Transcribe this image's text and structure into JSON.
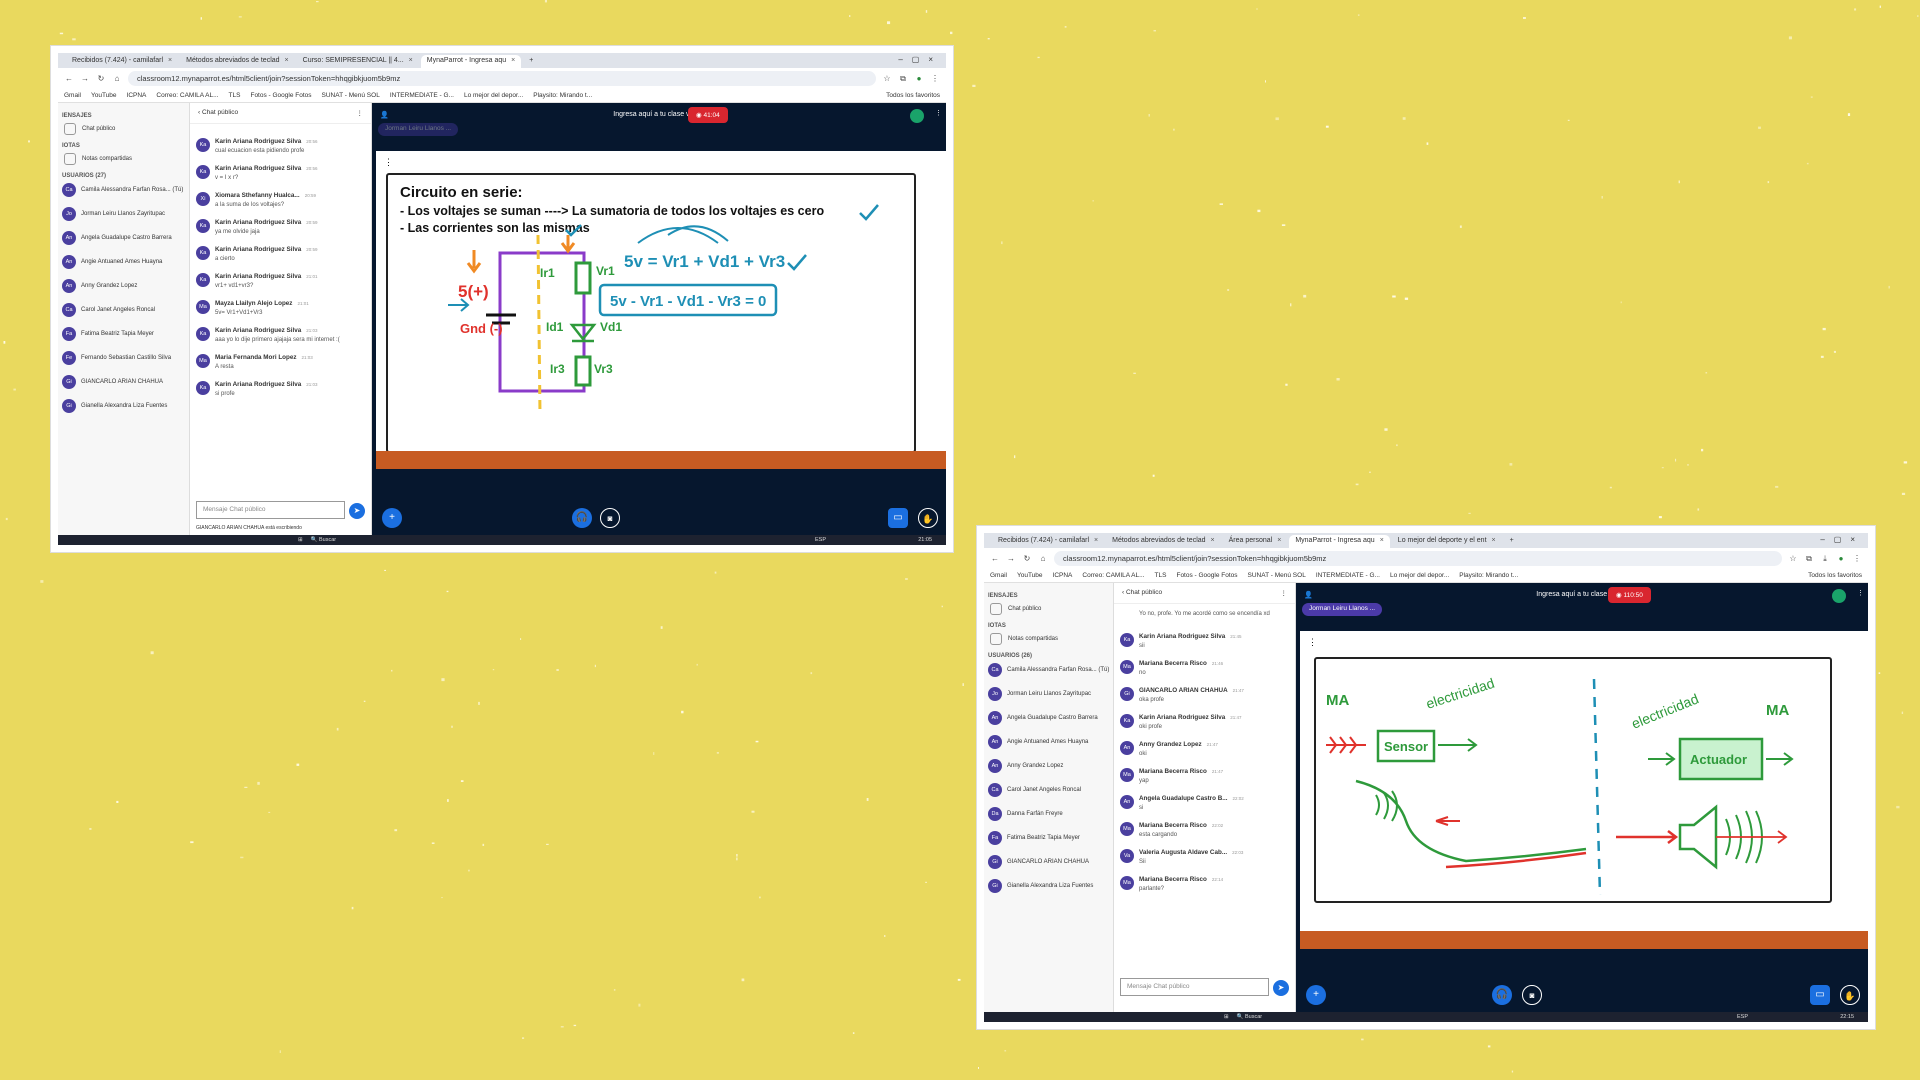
{
  "colors": {
    "background": "#e9d95e",
    "app_dark": "#06172e",
    "record_red": "#d9262f",
    "accent_blue": "#1b6fe0",
    "avatar": "#4a3f9f",
    "board_bottom": "#c75b22"
  },
  "common": {
    "url": "classroom12.mynaparrot.es/html5client/join?sessionToken=hhqgibkjuom5b9mz",
    "bookmarks": [
      "Gmail",
      "YouTube",
      "ICPNA",
      "Correo: CAMILA AL...",
      "TLS",
      "Fotos - Google Fotos",
      "SUNAT - Menú SOL",
      "INTERMEDIATE - G...",
      "Lo mejor del depor...",
      "Playsito: Mirando t..."
    ],
    "bookmarks_end": "Todos los favoritos",
    "sec_messages": "IENSAJES",
    "public_chat": "Chat público",
    "sec_notes": "IOTAS",
    "shared_notes": "Notas compartidas",
    "chat_header": "Chat público",
    "chat_placeholder": "Mensaje Chat público",
    "meeting_title": "Ingresa aquí a tu clase virtual",
    "presenter": "Jorman Leiru Llanos ...",
    "search": "Buscar",
    "lang": "ESP"
  },
  "s1": {
    "tabs": [
      "Recibidos (7.424) - camilafarl",
      "Métodos abreviados de teclad",
      "Curso: SEMIPRESENCIAL || 4...",
      "MynaParrot - Ingresa aqu"
    ],
    "users_header": "USUARIOS (27)",
    "users": [
      {
        "in": "Ca",
        "name": "Camila Alessandra Farfan Rosa... (Tú)"
      },
      {
        "in": "Jo",
        "name": "Jorman Leiru Llanos Zayritupac"
      },
      {
        "in": "An",
        "name": "Angela Guadalupe Castro Barrera"
      },
      {
        "in": "An",
        "name": "Angie Antuaned Ames Huayna"
      },
      {
        "in": "An",
        "name": "Anny Grandez Lopez"
      },
      {
        "in": "Ca",
        "name": "Carol Janet Angeles Roncal"
      },
      {
        "in": "Fa",
        "name": "Fatima Beatriz Tapia Meyer"
      },
      {
        "in": "Fe",
        "name": "Fernando Sebastian Castillo Silva"
      },
      {
        "in": "Gi",
        "name": "GIANCARLO ARIAN CHAHUA"
      },
      {
        "in": "Gi",
        "name": "Gianella Alexandra Liza Fuentes"
      }
    ],
    "messages": [
      {
        "in": "Ka",
        "who": "Karin Ariana Rodriguez Silva",
        "time": "20:56",
        "text": "cual ecuacion esta pidiendo profe"
      },
      {
        "in": "Ka",
        "who": "Karin Ariana Rodriguez Silva",
        "time": "20:56",
        "text": "v = I x r?"
      },
      {
        "in": "Xi",
        "who": "Xiomara Sthefanny Hualca...",
        "time": "20:59",
        "text": "a la suma de los voltajes?"
      },
      {
        "in": "Ka",
        "who": "Karin Ariana Rodriguez Silva",
        "time": "20:59",
        "text": "ya me olvide jaja"
      },
      {
        "in": "Ka",
        "who": "Karin Ariana Rodriguez Silva",
        "time": "20:59",
        "text": "a cierto"
      },
      {
        "in": "Ka",
        "who": "Karin Ariana Rodriguez Silva",
        "time": "21:01",
        "text": "vr1+ vd1+vr3?"
      },
      {
        "in": "Ma",
        "who": "Mayza Llailyn Alejo Lopez",
        "time": "21:01",
        "text": "5v= Vr1+Vd1+Vr3"
      },
      {
        "in": "Ka",
        "who": "Karin Ariana Rodriguez Silva",
        "time": "21:03",
        "text": "aaa yo lo dije primero ajajaja sera mi internet :("
      },
      {
        "in": "Ma",
        "who": "Maria Fernanda Mori Lopez",
        "time": "21:03",
        "text": "A resta"
      },
      {
        "in": "Ka",
        "who": "Karin Ariana Rodriguez Silva",
        "time": "21:03",
        "text": "si profe"
      }
    ],
    "typing": "GIANCARLO ARIAN CHAHUA está escribiendo",
    "record": "41:04",
    "board": {
      "title": "Circuito en serie:",
      "line1": "- Los voltajes se suman ----> La sumatoria de todos los voltajes es cero",
      "line2": "- Las corrientes son las mismas",
      "eq1": "5v = Vr1 + Vd1 + Vr3",
      "eq2": "5v - Vr1 - Vd1 - Vr3 = 0",
      "src": "5(+)",
      "gnd": "Gnd (-)",
      "ir1": "Ir1",
      "vr1": "Vr1",
      "id1": "Id1",
      "vd1": "Vd1",
      "ir3": "Ir3",
      "vr3": "Vr3"
    },
    "clock": "21:05"
  },
  "s2": {
    "tabs": [
      "Recibidos (7.424) - camilafarl",
      "Métodos abreviados de teclad",
      "Área personal",
      "MynaParrot - Ingresa aqu",
      "Lo mejor del deporte y el ent"
    ],
    "users_header": "USUARIOS (26)",
    "users": [
      {
        "in": "Ca",
        "name": "Camila Alessandra Farfan Rosa... (Tú)"
      },
      {
        "in": "Jo",
        "name": "Jorman Leiru Llanos Zayritupac"
      },
      {
        "in": "An",
        "name": "Angela Guadalupe Castro Barrera"
      },
      {
        "in": "An",
        "name": "Angie Antuaned Ames Huayna"
      },
      {
        "in": "An",
        "name": "Anny Grandez Lopez"
      },
      {
        "in": "Ca",
        "name": "Carol Janet Angeles Roncal"
      },
      {
        "in": "Da",
        "name": "Danna Farfán Freyre"
      },
      {
        "in": "Fa",
        "name": "Fatima Beatriz Tapia Meyer"
      },
      {
        "in": "Gi",
        "name": "GIANCARLO ARIAN CHAHUA"
      },
      {
        "in": "Gi",
        "name": "Gianella Alexandra Liza Fuentes"
      }
    ],
    "messages": [
      {
        "in": "Ka",
        "who": "Karin Ariana Rodriguez Silva",
        "time": "21:45",
        "text": "sii"
      },
      {
        "in": "Ma",
        "who": "Mariana Becerra Risco",
        "time": "21:46",
        "text": "no"
      },
      {
        "in": "Gi",
        "who": "GIANCARLO ARIAN CHAHUA",
        "time": "21:47",
        "text": "oka profe"
      },
      {
        "in": "Ka",
        "who": "Karin Ariana Rodriguez Silva",
        "time": "21:47",
        "text": "oki profe"
      },
      {
        "in": "An",
        "who": "Anny Grandez Lopez",
        "time": "21:47",
        "text": "oki"
      },
      {
        "in": "Ma",
        "who": "Mariana Becerra Risco",
        "time": "21:47",
        "text": "yap"
      },
      {
        "in": "An",
        "who": "Angela Guadalupe Castro B...",
        "time": "22:02",
        "text": "si"
      },
      {
        "in": "Ma",
        "who": "Mariana Becerra Risco",
        "time": "22:02",
        "text": "esta cargando"
      },
      {
        "in": "Va",
        "who": "Valeria Augusta Aldave Cab...",
        "time": "22:03",
        "text": "Sii"
      },
      {
        "in": "Ma",
        "who": "Mariana Becerra Risco",
        "time": "22:14",
        "text": "parlante?"
      }
    ],
    "top_msg": "Yo no, profe. Yo me acordé como se encendía xd",
    "record": "110:50",
    "board": {
      "ma1": "MA",
      "ma2": "MA",
      "elec1": "electricidad",
      "elec2": "electricidad",
      "sensor": "Sensor",
      "actuador": "Actuador"
    },
    "clock": "22:15"
  }
}
